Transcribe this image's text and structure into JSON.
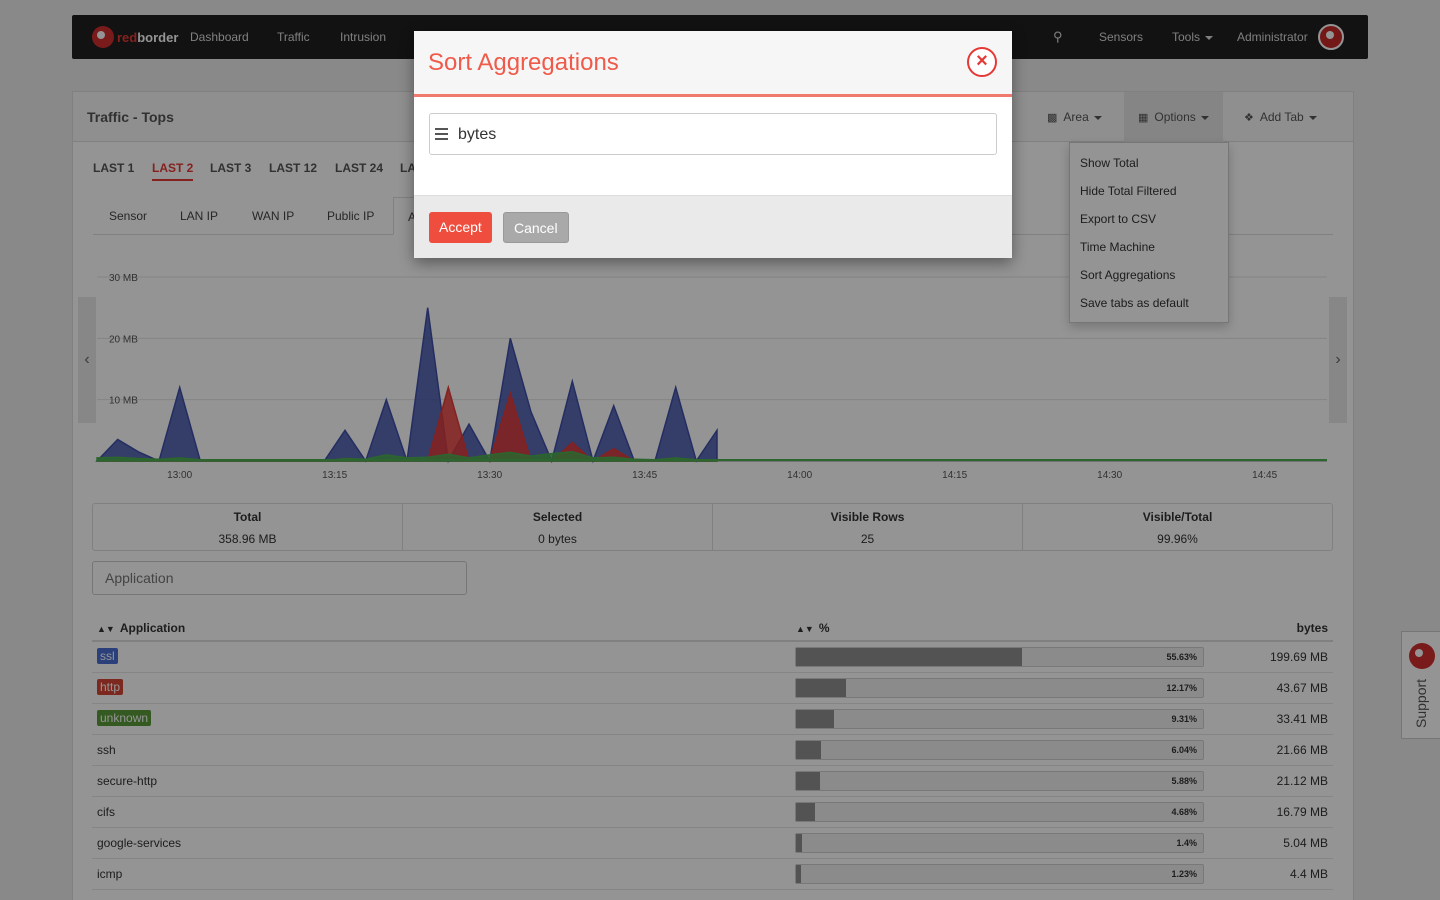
{
  "navbar": {
    "logo_red": "red",
    "logo_white": "border",
    "items": [
      {
        "label": "Dashboard"
      },
      {
        "label": "Traffic"
      },
      {
        "label": "Intrusion"
      }
    ],
    "right_items": {
      "sensors": "Sensors",
      "tools": "Tools",
      "user": "Administrator"
    },
    "search_icon": "search-icon"
  },
  "panel": {
    "title": "Traffic - Tops",
    "buttons": {
      "area": "Area",
      "options": "Options",
      "add_tab": "Add Tab"
    },
    "ranges": [
      "LAST 1",
      "LAST 2",
      "LAST 3",
      "LAST 12",
      "LAST 24",
      "LA"
    ],
    "active_range": "LAST 2",
    "sub_tabs": [
      "Sensor",
      "LAN IP",
      "WAN IP",
      "Public IP",
      "A"
    ]
  },
  "options_menu": [
    "Show Total",
    "Hide Total Filtered",
    "Export to CSV",
    "Time Machine",
    "Sort Aggregations",
    "Save tabs as default"
  ],
  "chart_data": {
    "type": "area",
    "x": [
      "12:52",
      "12:54",
      "12:56",
      "12:58",
      "13:00",
      "13:02",
      "13:04",
      "13:06",
      "13:08",
      "13:10",
      "13:12",
      "13:14",
      "13:16",
      "13:18",
      "13:20",
      "13:22",
      "13:24",
      "13:26",
      "13:28",
      "13:30",
      "13:32",
      "13:34",
      "13:36",
      "13:38",
      "13:40",
      "13:42",
      "13:44",
      "13:46",
      "13:48",
      "13:50",
      "13:52"
    ],
    "x_tick_labels": [
      "13:00",
      "13:15",
      "13:30",
      "13:45",
      "14:00",
      "14:15",
      "14:30",
      "14:45"
    ],
    "y_tick_labels": [
      "10 MB",
      "20 MB",
      "30 MB"
    ],
    "ylim": [
      0,
      30
    ],
    "series": [
      {
        "color": "#3f4fa8",
        "values": [
          0,
          3.5,
          1.5,
          0,
          12,
          0,
          0,
          0,
          0,
          0,
          0,
          0,
          5,
          0,
          10,
          0,
          25,
          0,
          6,
          0,
          20,
          8,
          0,
          13,
          0,
          9,
          0,
          0,
          12,
          0,
          5
        ]
      },
      {
        "color": "#e53935",
        "values": [
          0,
          0,
          0,
          0,
          0,
          0,
          0,
          0,
          0,
          0,
          0,
          0,
          0,
          0,
          0,
          0,
          0,
          12,
          0,
          0,
          11,
          0,
          0,
          3,
          0,
          2,
          0,
          0,
          0,
          0,
          0
        ]
      },
      {
        "color": "#4caf50",
        "values": [
          0.5,
          0.6,
          0.4,
          0.3,
          0.5,
          0.2,
          0,
          0,
          0,
          0,
          0,
          0,
          0.4,
          0.3,
          1,
          0.5,
          0.6,
          1.1,
          0.5,
          1,
          1.4,
          0.8,
          1.2,
          1.5,
          0.5,
          0.6,
          0.3,
          0.2,
          0.5,
          0.2,
          0.1
        ]
      }
    ]
  },
  "summary": {
    "total_label": "Total",
    "total_value": "358.96 MB",
    "selected_label": "Selected",
    "selected_value": "0 bytes",
    "rows_label": "Visible Rows",
    "rows_value": "25",
    "ratio_label": "Visible/Total",
    "ratio_value": "99.96%"
  },
  "filter": {
    "placeholder": "Application"
  },
  "table": {
    "headers": {
      "application": "Application",
      "percent": "%",
      "bytes": "bytes"
    },
    "rows": [
      {
        "app": "ssl",
        "badge_color": "#4a6fd4",
        "pct": 55.63,
        "pct_label": "55.63%",
        "bytes": "199.69 MB"
      },
      {
        "app": "http",
        "badge_color": "#d64535",
        "pct": 12.17,
        "pct_label": "12.17%",
        "bytes": "43.67 MB"
      },
      {
        "app": "unknown",
        "badge_color": "#5a9a3a",
        "pct": 9.31,
        "pct_label": "9.31%",
        "bytes": "33.41 MB"
      },
      {
        "app": "ssh",
        "badge_color": "",
        "pct": 6.04,
        "pct_label": "6.04%",
        "bytes": "21.66 MB"
      },
      {
        "app": "secure-http",
        "badge_color": "",
        "pct": 5.88,
        "pct_label": "5.88%",
        "bytes": "21.12 MB"
      },
      {
        "app": "cifs",
        "badge_color": "",
        "pct": 4.68,
        "pct_label": "4.68%",
        "bytes": "16.79 MB"
      },
      {
        "app": "google-services",
        "badge_color": "",
        "pct": 1.4,
        "pct_label": "1.4%",
        "bytes": "5.04 MB"
      },
      {
        "app": "icmp",
        "badge_color": "",
        "pct": 1.23,
        "pct_label": "1.23%",
        "bytes": "4.4 MB"
      }
    ]
  },
  "modal": {
    "title": "Sort Aggregations",
    "close_symbol": "×",
    "item_label": "bytes",
    "accept_label": "Accept",
    "cancel_label": "Cancel"
  },
  "support": {
    "label": "Support"
  }
}
